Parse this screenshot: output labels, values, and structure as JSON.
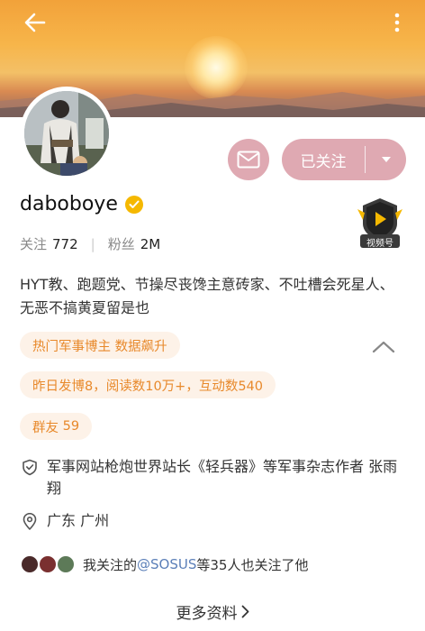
{
  "profile": {
    "username": "daboboye",
    "stats": {
      "following_label": "关注",
      "following_value": "772",
      "followers_label": "粉丝",
      "followers_value": "2M"
    },
    "bio": "HYT教、跑题党、节操尽丧馋主意砖家、不吐槽会死星人、无恶不搞黄夏留是也"
  },
  "actions": {
    "follow_label": "已关注"
  },
  "badges": {
    "video_label": "视频号"
  },
  "tags": {
    "hot": "热门军事博主 数据飙升",
    "stat": "昨日发博8，阅读数10万+，互动数540",
    "group_label": "群友",
    "group_count": "59"
  },
  "info": {
    "work": "军事网站枪炮世界站长《轻兵器》等军事杂志作者  张雨翔",
    "location": "广东 广州"
  },
  "mutual": {
    "prefix": "我关注的",
    "mention": "@SOSUS",
    "suffix": "等35人也关注了他"
  },
  "more_info_label": "更多资料",
  "colors": {
    "accent_pink": "#dfa9b2",
    "tag_bg": "#fdf2e8",
    "tag_text": "#e8892b",
    "verified": "#f5b800",
    "link": "#5b7fb8"
  },
  "icons": [
    "back-arrow-icon",
    "more-vertical-icon",
    "mail-icon",
    "chevron-down-icon",
    "verified-icon",
    "video-account-icon",
    "chevron-up-icon",
    "shield-icon",
    "location-pin-icon",
    "chevron-right-icon"
  ]
}
